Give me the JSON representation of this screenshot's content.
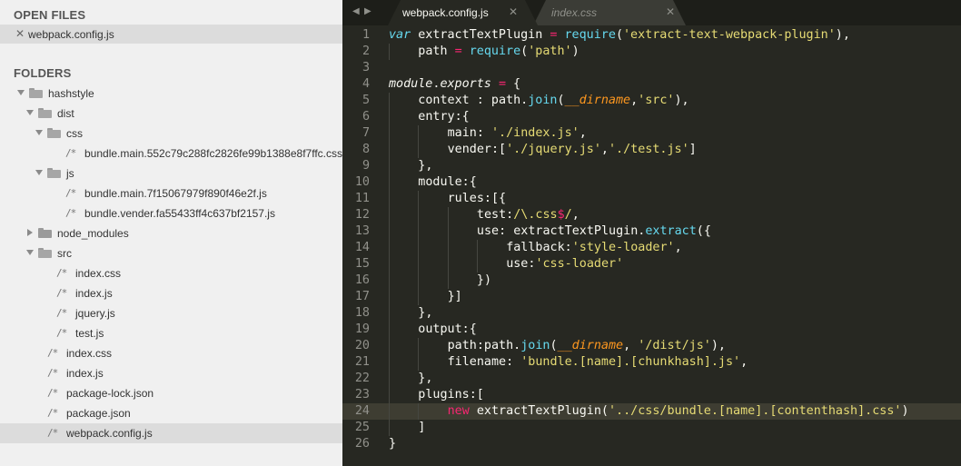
{
  "sidebar": {
    "open_files_header": "OPEN FILES",
    "open_files": [
      {
        "close_glyph": "✕",
        "name": "webpack.config.js"
      }
    ],
    "folders_header": "FOLDERS",
    "tree": [
      {
        "name": "hashstyle",
        "kind": "folder",
        "expanded": true,
        "depth": 0,
        "icon": "folder-open-icon"
      },
      {
        "name": "dist",
        "kind": "folder",
        "expanded": true,
        "depth": 1,
        "icon": "folder-open-icon"
      },
      {
        "name": "css",
        "kind": "folder",
        "expanded": true,
        "depth": 2,
        "icon": "folder-open-icon"
      },
      {
        "name": "bundle.main.552c79c288fc2826fe99b1388e8f7ffc.css",
        "kind": "file",
        "depth": 3,
        "icon": "file-comment-icon"
      },
      {
        "name": "js",
        "kind": "folder",
        "expanded": true,
        "depth": 2,
        "icon": "folder-open-icon"
      },
      {
        "name": "bundle.main.7f15067979f890f46e2f.js",
        "kind": "file",
        "depth": 3,
        "icon": "file-comment-icon"
      },
      {
        "name": "bundle.vender.fa55433ff4c637bf2157.js",
        "kind": "file",
        "depth": 3,
        "icon": "file-comment-icon"
      },
      {
        "name": "node_modules",
        "kind": "folder",
        "expanded": false,
        "depth": 1,
        "icon": "folder-closed-icon"
      },
      {
        "name": "src",
        "kind": "folder",
        "expanded": true,
        "depth": 1,
        "icon": "folder-open-icon"
      },
      {
        "name": "index.css",
        "kind": "file",
        "depth": 2,
        "icon": "file-comment-icon"
      },
      {
        "name": "index.js",
        "kind": "file",
        "depth": 2,
        "icon": "file-comment-icon"
      },
      {
        "name": "jquery.js",
        "kind": "file",
        "depth": 2,
        "icon": "file-comment-icon"
      },
      {
        "name": "test.js",
        "kind": "file",
        "depth": 2,
        "icon": "file-comment-icon"
      },
      {
        "name": "index.css",
        "kind": "file",
        "depth": 1,
        "icon": "file-comment-icon"
      },
      {
        "name": "index.js",
        "kind": "file",
        "depth": 1,
        "icon": "file-comment-icon"
      },
      {
        "name": "package-lock.json",
        "kind": "file",
        "depth": 1,
        "icon": "file-comment-icon"
      },
      {
        "name": "package.json",
        "kind": "file",
        "depth": 1,
        "icon": "file-comment-icon"
      },
      {
        "name": "webpack.config.js",
        "kind": "file",
        "depth": 1,
        "icon": "file-comment-icon",
        "selected": true
      }
    ]
  },
  "file_glyph": "/*",
  "tabs": {
    "nav_left": "◀",
    "nav_right": "▶",
    "items": [
      {
        "label": "webpack.config.js",
        "active": true,
        "close": "✕"
      },
      {
        "label": "index.css",
        "active": false,
        "close": "✕"
      }
    ]
  },
  "editor": {
    "current_line": 24,
    "lines": [
      {
        "n": "1",
        "guides": 0,
        "tokens": [
          [
            "kw",
            "var"
          ],
          [
            "pl",
            " extractTextPlugin "
          ],
          [
            "op",
            "="
          ],
          [
            "pl",
            " "
          ],
          [
            "fn",
            "require"
          ],
          [
            "pl",
            "("
          ],
          [
            "str",
            "'extract-text-webpack-plugin'"
          ],
          [
            "pl",
            "),"
          ]
        ]
      },
      {
        "n": "2",
        "guides": 1,
        "tokens": [
          [
            "pl",
            "path "
          ],
          [
            "op",
            "="
          ],
          [
            "pl",
            " "
          ],
          [
            "fn",
            "require"
          ],
          [
            "pl",
            "("
          ],
          [
            "str",
            "'path'"
          ],
          [
            "pl",
            ")"
          ]
        ]
      },
      {
        "n": "3",
        "guides": 0,
        "tokens": []
      },
      {
        "n": "4",
        "guides": 0,
        "tokens": [
          [
            "it",
            "module"
          ],
          [
            "pl",
            "."
          ],
          [
            "it",
            "exports"
          ],
          [
            "pl",
            " "
          ],
          [
            "op",
            "="
          ],
          [
            "pl",
            " {"
          ]
        ]
      },
      {
        "n": "5",
        "guides": 1,
        "tokens": [
          [
            "pl",
            "context : path."
          ],
          [
            "fn",
            "join"
          ],
          [
            "pl",
            "("
          ],
          [
            "sp",
            "__dirname"
          ],
          [
            "pl",
            ","
          ],
          [
            "str",
            "'src'"
          ],
          [
            "pl",
            "),"
          ]
        ]
      },
      {
        "n": "6",
        "guides": 1,
        "tokens": [
          [
            "pl",
            "entry:{"
          ]
        ]
      },
      {
        "n": "7",
        "guides": 2,
        "tokens": [
          [
            "pl",
            "main: "
          ],
          [
            "str",
            "'./index.js'"
          ],
          [
            "pl",
            ","
          ]
        ]
      },
      {
        "n": "8",
        "guides": 2,
        "tokens": [
          [
            "pl",
            "vender:["
          ],
          [
            "str",
            "'./jquery.js'"
          ],
          [
            "pl",
            ","
          ],
          [
            "str",
            "'./test.js'"
          ],
          [
            "pl",
            "]"
          ]
        ]
      },
      {
        "n": "9",
        "guides": 1,
        "tokens": [
          [
            "pl",
            "},"
          ]
        ]
      },
      {
        "n": "10",
        "guides": 1,
        "tokens": [
          [
            "pl",
            "module:{"
          ]
        ]
      },
      {
        "n": "11",
        "guides": 2,
        "tokens": [
          [
            "pl",
            "rules:[{"
          ]
        ]
      },
      {
        "n": "12",
        "guides": 3,
        "tokens": [
          [
            "pl",
            "test:"
          ],
          [
            "str",
            "/\\.css"
          ],
          [
            "op",
            "$"
          ],
          [
            "str",
            "/"
          ],
          [
            "pl",
            ","
          ]
        ]
      },
      {
        "n": "13",
        "guides": 3,
        "tokens": [
          [
            "pl",
            "use: extractTextPlugin."
          ],
          [
            "fn",
            "extract"
          ],
          [
            "pl",
            "({"
          ]
        ]
      },
      {
        "n": "14",
        "guides": 4,
        "tokens": [
          [
            "pl",
            "fallback:"
          ],
          [
            "str",
            "'style-loader'"
          ],
          [
            "pl",
            ","
          ]
        ]
      },
      {
        "n": "15",
        "guides": 4,
        "tokens": [
          [
            "pl",
            "use:"
          ],
          [
            "str",
            "'css-loader'"
          ]
        ]
      },
      {
        "n": "16",
        "guides": 3,
        "tokens": [
          [
            "pl",
            "})"
          ]
        ]
      },
      {
        "n": "17",
        "guides": 2,
        "tokens": [
          [
            "pl",
            "}]"
          ]
        ]
      },
      {
        "n": "18",
        "guides": 1,
        "tokens": [
          [
            "pl",
            "},"
          ]
        ]
      },
      {
        "n": "19",
        "guides": 1,
        "tokens": [
          [
            "pl",
            "output:{"
          ]
        ]
      },
      {
        "n": "20",
        "guides": 2,
        "tokens": [
          [
            "pl",
            "path:path."
          ],
          [
            "fn",
            "join"
          ],
          [
            "pl",
            "("
          ],
          [
            "sp",
            "__dirname"
          ],
          [
            "pl",
            ", "
          ],
          [
            "str",
            "'/dist/js'"
          ],
          [
            "pl",
            "),"
          ]
        ]
      },
      {
        "n": "21",
        "guides": 2,
        "tokens": [
          [
            "pl",
            "filename: "
          ],
          [
            "str",
            "'bundle.[name].[chunkhash].js'"
          ],
          [
            "pl",
            ","
          ]
        ]
      },
      {
        "n": "22",
        "guides": 1,
        "tokens": [
          [
            "pl",
            "},"
          ]
        ]
      },
      {
        "n": "23",
        "guides": 1,
        "tokens": [
          [
            "pl",
            "plugins:["
          ]
        ]
      },
      {
        "n": "24",
        "guides": 2,
        "tokens": [
          [
            "op",
            "new"
          ],
          [
            "pl",
            " extractTextPlugin("
          ],
          [
            "str",
            "'../css/bundle.[name].[contenthash].css'"
          ],
          [
            "pl",
            ")"
          ]
        ]
      },
      {
        "n": "25",
        "guides": 1,
        "tokens": [
          [
            "pl",
            "]"
          ]
        ]
      },
      {
        "n": "26",
        "guides": 0,
        "tokens": [
          [
            "pl",
            "}"
          ]
        ]
      }
    ]
  }
}
